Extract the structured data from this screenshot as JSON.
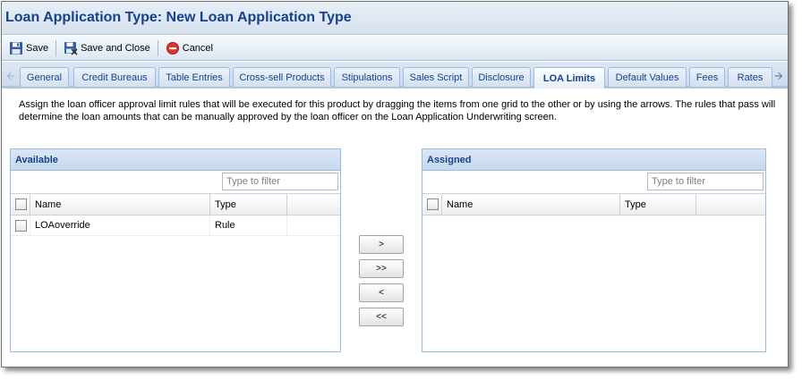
{
  "window": {
    "title": "Loan Application Type: New Loan Application Type"
  },
  "toolbar": {
    "save_label": "Save",
    "save_close_label": "Save and Close",
    "cancel_label": "Cancel"
  },
  "tabs": [
    "General",
    "Credit Bureaus",
    "Table Entries",
    "Cross-sell Products",
    "Stipulations",
    "Sales Script",
    "Disclosure",
    "LOA Limits",
    "Default Values",
    "Fees",
    "Rates"
  ],
  "active_tab": "LOA Limits",
  "description": "Assign the loan officer approval limit rules that will be executed for this product by dragging the items from one grid to the other or by using the arrows. The rules that pass will determine the loan amounts that can be manually approved by the loan officer on the Loan Application Underwriting screen.",
  "available": {
    "title": "Available",
    "filter_placeholder": "Type to filter",
    "columns": {
      "name": "Name",
      "type": "Type"
    },
    "rows": [
      {
        "name": "LOAoverride",
        "type": "Rule"
      }
    ]
  },
  "assigned": {
    "title": "Assigned",
    "filter_placeholder": "Type to filter",
    "columns": {
      "name": "Name",
      "type": "Type"
    },
    "rows": []
  },
  "move_buttons": {
    "assign_one": ">",
    "assign_all": ">>",
    "remove_one": "<",
    "remove_all": "<<"
  },
  "colors": {
    "header_text": "#15428b",
    "tab_border": "#99bbe8",
    "cancel_red": "#d9352b"
  }
}
